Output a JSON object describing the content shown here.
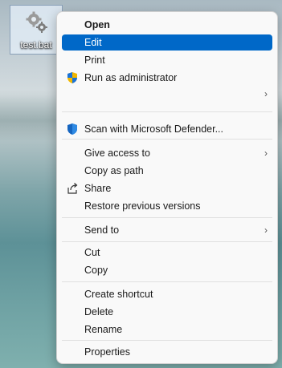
{
  "desktop": {
    "file_icon_label": "test.bat"
  },
  "context_menu": {
    "open": "Open",
    "edit": "Edit",
    "print": "Print",
    "run_as_admin": "Run as administrator",
    "scan_defender": "Scan with Microsoft Defender...",
    "give_access": "Give access to",
    "copy_as_path": "Copy as path",
    "share": "Share",
    "restore_versions": "Restore previous versions",
    "send_to": "Send to",
    "cut": "Cut",
    "copy": "Copy",
    "create_shortcut": "Create shortcut",
    "delete": "Delete",
    "rename": "Rename",
    "properties": "Properties"
  },
  "colors": {
    "highlight": "#0068c8",
    "menu_bg": "#f9f9f9"
  }
}
